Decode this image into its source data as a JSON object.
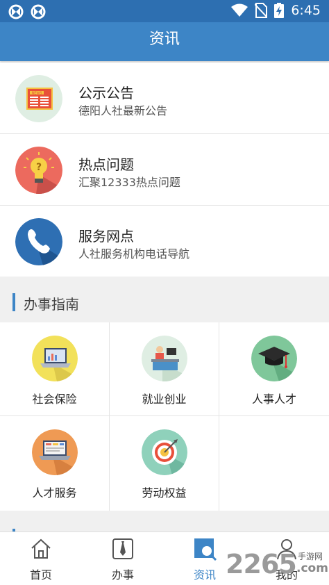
{
  "status_bar": {
    "time": "6:45",
    "colors": {
      "bg": "#2d6fb1"
    }
  },
  "app_bar": {
    "title": "资讯",
    "color": "#3d85c6"
  },
  "news": [
    {
      "title": "公示公告",
      "subtitle": "德阳人社最新公告",
      "icon": "newspaper-icon",
      "badge": "NEWS"
    },
    {
      "title": "热点问题",
      "subtitle": "汇聚12333热点问题",
      "icon": "lightbulb-icon"
    },
    {
      "title": "服务网点",
      "subtitle": "人社服务机构电话导航",
      "icon": "phone-icon"
    }
  ],
  "guide": {
    "heading": "办事指南",
    "items": [
      {
        "label": "社会保险",
        "icon": "laptop-chart-icon"
      },
      {
        "label": "就业创业",
        "icon": "office-worker-icon"
      },
      {
        "label": "人事人才",
        "icon": "graduation-cap-icon"
      },
      {
        "label": "人才服务",
        "icon": "laptop-icon"
      },
      {
        "label": "劳动权益",
        "icon": "target-icon"
      }
    ]
  },
  "tabs": [
    {
      "label": "首页",
      "icon": "home-icon",
      "active": false
    },
    {
      "label": "办事",
      "icon": "tie-icon",
      "active": false
    },
    {
      "label": "资讯",
      "icon": "search-news-icon",
      "active": true
    },
    {
      "label": "我的",
      "icon": "user-icon",
      "active": false
    }
  ],
  "watermark": {
    "number": "2265",
    "line1": "手游网",
    "line2": ".com"
  }
}
